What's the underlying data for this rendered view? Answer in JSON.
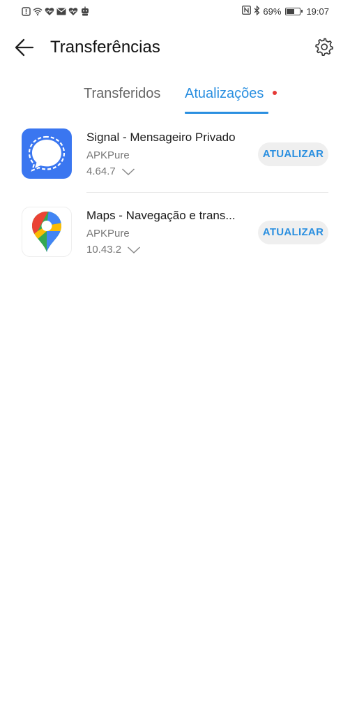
{
  "status_bar": {
    "battery": "69%",
    "time": "19:07",
    "battery_level": 0.69,
    "left_icons": [
      "alert-icon",
      "wifi-icon",
      "heart-icon",
      "mail-icon",
      "heart-icon",
      "robot-icon"
    ],
    "right_icons": [
      "nfc-icon",
      "bluetooth-icon",
      "battery-icon"
    ]
  },
  "header": {
    "title": "Transferências",
    "back_icon": "arrow-left-icon",
    "settings_icon": "gear-icon"
  },
  "tabs": [
    {
      "label": "Transferidos",
      "active": false
    },
    {
      "label": "Atualizações",
      "active": true,
      "has_badge": true
    }
  ],
  "apps": [
    {
      "name": "Signal - Mensageiro Privado",
      "source": "APKPure",
      "version": "4.64.7",
      "button": "ATUALIZAR",
      "icon": "signal-icon"
    },
    {
      "name": "Maps - Navegação e trans...",
      "source": "APKPure",
      "version": "10.43.2",
      "button": "ATUALIZAR",
      "icon": "maps-pin-icon"
    }
  ],
  "colors": {
    "accent": "#2a8fe0",
    "badge": "#e53935",
    "signal": "#3a76f0"
  }
}
